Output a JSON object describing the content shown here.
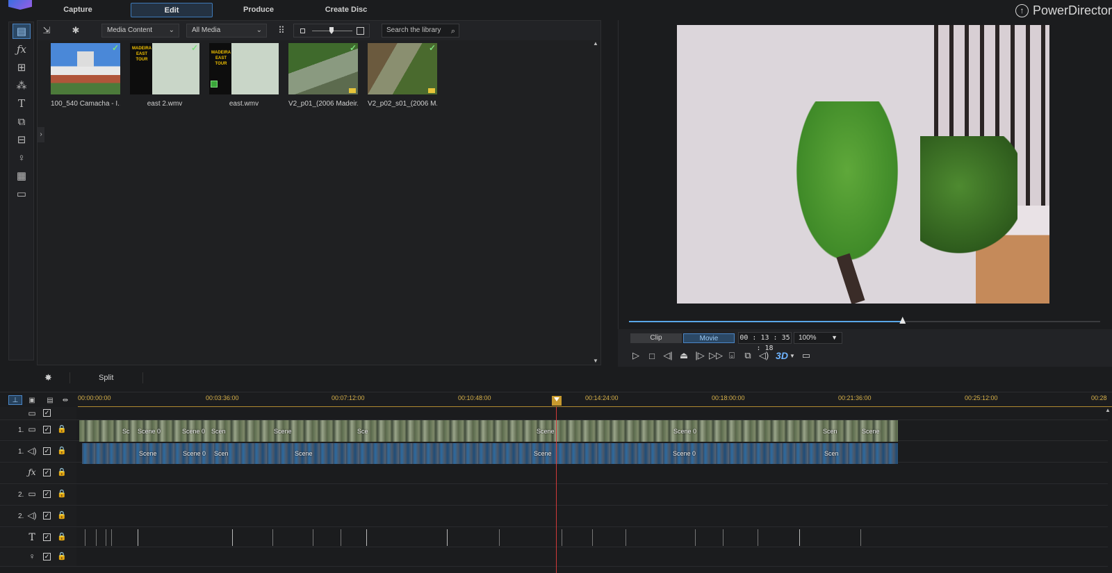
{
  "app": {
    "brand_name": "PowerDirector",
    "brand_icon": "upload-circle-icon",
    "accent_color": "#3e7ab8"
  },
  "nav": {
    "tabs": [
      {
        "label": "Capture",
        "active": false
      },
      {
        "label": "Edit",
        "active": true
      },
      {
        "label": "Produce",
        "active": false
      },
      {
        "label": "Create Disc",
        "active": false
      }
    ]
  },
  "sidebar": {
    "items": [
      {
        "icon": "media-room-icon",
        "glyph": "▤",
        "active": true
      },
      {
        "icon": "effects-room-icon",
        "glyph": "ƒx",
        "active": false
      },
      {
        "icon": "pip-room-icon",
        "glyph": "⊞",
        "active": false
      },
      {
        "icon": "particle-room-icon",
        "glyph": "⁂",
        "active": false
      },
      {
        "icon": "title-room-icon",
        "glyph": "T",
        "active": false
      },
      {
        "icon": "transition-room-icon",
        "glyph": "⧉",
        "active": false
      },
      {
        "icon": "audio-mixing-room-icon",
        "glyph": "⊟",
        "active": false
      },
      {
        "icon": "voice-over-icon",
        "glyph": "🎙",
        "active": false
      },
      {
        "icon": "chapter-room-icon",
        "glyph": "▦",
        "active": false
      },
      {
        "icon": "subtitle-room-icon",
        "glyph": "▭",
        "active": false
      }
    ]
  },
  "library": {
    "filter_content": "Media Content",
    "filter_media": "All Media",
    "search_placeholder": "Search the library",
    "items": [
      {
        "caption": "100_540 Camacha - I...",
        "checked": true,
        "badge": ""
      },
      {
        "caption": "east 2.wmv",
        "checked": true,
        "badge": "",
        "thumb_text": "MADEIRA EAST TOUR"
      },
      {
        "caption": "east.wmv",
        "checked": false,
        "badge": "film",
        "thumb_text": "MADEIRA EAST TOUR"
      },
      {
        "caption": "V2_p01_(2006 Madeir...",
        "checked": true,
        "badge": "folder"
      },
      {
        "caption": "V2_p02_s01_(2006 M...",
        "checked": true,
        "badge": "folder"
      }
    ]
  },
  "preview": {
    "mode_clip": "Clip",
    "mode_movie": "Movie",
    "active_mode": "Movie",
    "timecode": "00 : 13 : 35 : 18",
    "zoom": "100%",
    "progress": 0.58,
    "three_d_label": "3D"
  },
  "timeline": {
    "split_label": "Split",
    "ruler_labels": [
      "00:00:00:00",
      "00:03:36:00",
      "00:07:12:00",
      "00:10:48:00",
      "00:14:24:00",
      "00:18:00:00",
      "00:21:36:00",
      "00:25:12:00",
      "00:28"
    ],
    "tracks": [
      {
        "num": "",
        "icon": "video-track-icon",
        "glyph": "▭",
        "lock": false
      },
      {
        "num": "1.",
        "icon": "video-track-icon",
        "glyph": "▭",
        "lock": true
      },
      {
        "num": "1.",
        "icon": "audio-track-icon",
        "glyph": "◁)",
        "lock": true
      },
      {
        "num": "",
        "icon": "fx-track-icon",
        "glyph": "ƒx",
        "lock": true
      },
      {
        "num": "2.",
        "icon": "video-track-icon",
        "glyph": "▭",
        "lock": true
      },
      {
        "num": "2.",
        "icon": "audio-track-icon",
        "glyph": "◁)",
        "lock": true
      },
      {
        "num": "",
        "icon": "title-track-icon",
        "glyph": "T",
        "lock": true
      },
      {
        "num": "",
        "icon": "voice-track-icon",
        "glyph": "🎙",
        "lock": true
      }
    ],
    "clip_labels": [
      "S",
      "Sc",
      "Scene 0",
      "Scene 0",
      "Scen",
      "Scen",
      "Scene",
      "Sce",
      "Sc",
      "Sce",
      "Scene",
      "Scene 0",
      "Scen",
      "Scen"
    ]
  }
}
